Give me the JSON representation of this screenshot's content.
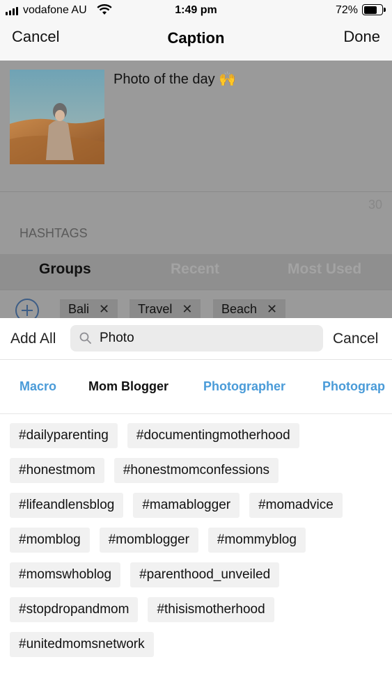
{
  "status_bar": {
    "carrier": "vodafone AU",
    "time": "1:49 pm",
    "battery": "72%",
    "battery_level": 0.72
  },
  "nav": {
    "cancel": "Cancel",
    "title": "Caption",
    "done": "Done"
  },
  "post": {
    "caption": "Photo of the day 🙌",
    "char_count": "30"
  },
  "hashtags": {
    "label": "HASHTAGS",
    "segments": [
      "Groups",
      "Recent",
      "Most Used"
    ],
    "active_segment": "Groups",
    "groups": [
      "Bali",
      "Travel",
      "Beach"
    ]
  },
  "search": {
    "add_all": "Add All",
    "query": "Photo",
    "cancel": "Cancel"
  },
  "categories": [
    "Macro",
    "Mom Blogger",
    "Photographer",
    "Photograp"
  ],
  "active_category": "Mom Blogger",
  "tags": [
    [
      "#dailyparenting",
      "#documentingmotherhood"
    ],
    [
      "#honestmom",
      "#honestmomconfessions"
    ],
    [
      "#lifeandlensblog",
      "#mamablogger",
      "#momadvice"
    ],
    [
      "#momblog",
      "#momblogger",
      "#mommyblog"
    ],
    [
      "#momswhoblog",
      "#parenthood_unveiled"
    ],
    [
      "#stopdropandmom",
      "#thisismotherhood"
    ],
    [
      "#unitedmomsnetwork"
    ]
  ],
  "colors": {
    "link": "#4a9bd8",
    "dim": "#9a9a9a",
    "chip": "#f1f1f1"
  }
}
